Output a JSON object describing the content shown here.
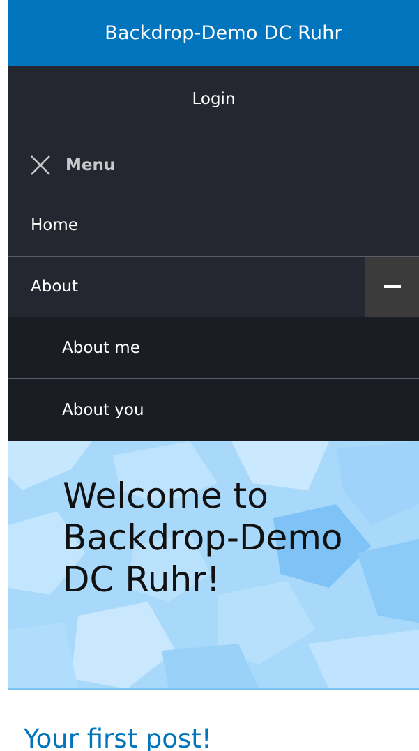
{
  "header": {
    "site_name": "Backdrop-Demo DC Ruhr"
  },
  "user_menu": {
    "login_label": "Login"
  },
  "menu": {
    "toggle_label": "Menu",
    "items": [
      {
        "label": "Home"
      },
      {
        "label": "About",
        "expanded": true,
        "children": [
          {
            "label": "About me"
          },
          {
            "label": "About you"
          }
        ]
      }
    ]
  },
  "hero": {
    "title_lines": [
      "Welcome to",
      "Backdrop-Demo",
      "DC Ruhr!"
    ]
  },
  "content": {
    "post_title": "Your first post!"
  },
  "colors": {
    "header_bg": "#0074bd",
    "nav_bg": "#24272f",
    "submenu_bg": "#1a1d24",
    "hero_bg": "#a8d9fb",
    "link": "#0074bd"
  },
  "icons": {
    "menu_toggle": "close-icon",
    "submenu_toggle": "minus-icon"
  }
}
